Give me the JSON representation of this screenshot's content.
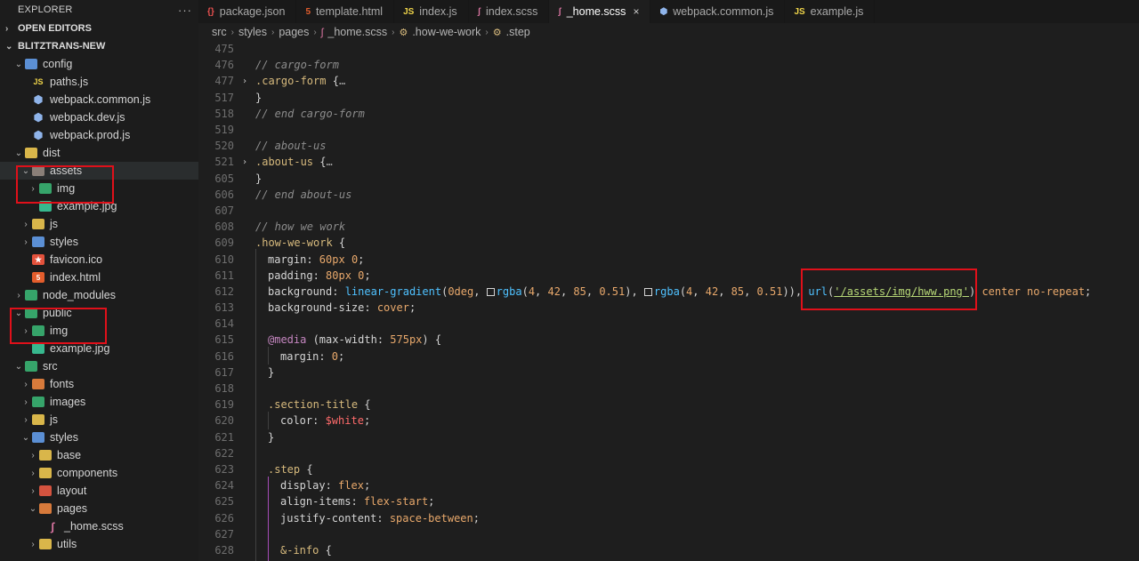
{
  "explorer": {
    "title": "EXPLORER",
    "more": "···",
    "open_editors": "OPEN EDITORS",
    "project": "BLITZTRANS-NEW"
  },
  "tree": [
    {
      "label": "config",
      "depth": 1,
      "type": "folder",
      "color": "#5b8fd4",
      "chev": "⌄"
    },
    {
      "label": "paths.js",
      "depth": 2,
      "type": "js"
    },
    {
      "label": "webpack.common.js",
      "depth": 2,
      "type": "webpack"
    },
    {
      "label": "webpack.dev.js",
      "depth": 2,
      "type": "webpack"
    },
    {
      "label": "webpack.prod.js",
      "depth": 2,
      "type": "webpack"
    },
    {
      "label": "dist",
      "depth": 1,
      "type": "folder",
      "color": "#d9b64a",
      "chev": "⌄"
    },
    {
      "label": "assets",
      "depth": 2,
      "type": "folder",
      "color": "#8a7f78",
      "chev": "⌄",
      "selected": true
    },
    {
      "label": "img",
      "depth": 3,
      "type": "folder",
      "color": "#36a46a",
      "chev": "›"
    },
    {
      "label": "example.jpg",
      "depth": 3,
      "type": "image"
    },
    {
      "label": "js",
      "depth": 2,
      "type": "folder",
      "color": "#d9b64a",
      "chev": "›"
    },
    {
      "label": "styles",
      "depth": 2,
      "type": "folder",
      "color": "#5b8fd4",
      "chev": "›"
    },
    {
      "label": "favicon.ico",
      "depth": 2,
      "type": "favicon"
    },
    {
      "label": "index.html",
      "depth": 2,
      "type": "html"
    },
    {
      "label": "node_modules",
      "depth": 1,
      "type": "folder",
      "color": "#36a46a",
      "chev": "›"
    },
    {
      "label": "public",
      "depth": 1,
      "type": "folder",
      "color": "#36a46a",
      "chev": "⌄"
    },
    {
      "label": "img",
      "depth": 2,
      "type": "folder",
      "color": "#36a46a",
      "chev": "›"
    },
    {
      "label": "example.jpg",
      "depth": 2,
      "type": "image"
    },
    {
      "label": "src",
      "depth": 1,
      "type": "folder",
      "color": "#36a46a",
      "chev": "⌄"
    },
    {
      "label": "fonts",
      "depth": 2,
      "type": "folder",
      "color": "#d77a3b",
      "chev": "›"
    },
    {
      "label": "images",
      "depth": 2,
      "type": "folder",
      "color": "#36a46a",
      "chev": "›"
    },
    {
      "label": "js",
      "depth": 2,
      "type": "folder",
      "color": "#d9b64a",
      "chev": "›"
    },
    {
      "label": "styles",
      "depth": 2,
      "type": "folder",
      "color": "#5b8fd4",
      "chev": "⌄"
    },
    {
      "label": "base",
      "depth": 3,
      "type": "folder",
      "color": "#d9b64a",
      "chev": "›"
    },
    {
      "label": "components",
      "depth": 3,
      "type": "folder",
      "color": "#d9b64a",
      "chev": "›"
    },
    {
      "label": "layout",
      "depth": 3,
      "type": "folder",
      "color": "#d4533f",
      "chev": "›"
    },
    {
      "label": "pages",
      "depth": 3,
      "type": "folder",
      "color": "#d77a3b",
      "chev": "⌄"
    },
    {
      "label": "_home.scss",
      "depth": 4,
      "type": "sass"
    },
    {
      "label": "utils",
      "depth": 3,
      "type": "folder",
      "color": "#d9b64a",
      "chev": "›"
    }
  ],
  "tabs": [
    {
      "label": "package.json",
      "icon": "{}",
      "icon_color": "#e8504f",
      "active": false
    },
    {
      "label": "template.html",
      "icon": "5",
      "icon_color": "#e35d2c",
      "active": false
    },
    {
      "label": "index.js",
      "icon": "JS",
      "icon_color": "#f0d54a",
      "active": false
    },
    {
      "label": "index.scss",
      "icon": "ʃ",
      "icon_color": "#d7739f",
      "active": false
    },
    {
      "label": "_home.scss",
      "icon": "ʃ",
      "icon_color": "#d7739f",
      "active": true
    },
    {
      "label": "webpack.common.js",
      "icon": "⬢",
      "icon_color": "#8fb4ea",
      "active": false
    },
    {
      "label": "example.js",
      "icon": "JS",
      "icon_color": "#f0d54a",
      "active": false
    }
  ],
  "close_glyph": "×",
  "breadcrumb": {
    "src": "src",
    "styles": "styles",
    "pages": "pages",
    "file": "_home.scss",
    "sym1": ".how-we-work",
    "sym2": ".step"
  },
  "code_lines": [
    {
      "n": "475",
      "indent": 0,
      "tokens": []
    },
    {
      "n": "476",
      "indent": 0,
      "tokens": [
        [
          "c",
          "// cargo-form"
        ]
      ]
    },
    {
      "n": "477",
      "indent": 0,
      "fold": "›",
      "tokens": [
        [
          "s",
          ".cargo-form"
        ],
        [
          "p",
          " {"
        ],
        [
          "e",
          "…"
        ]
      ]
    },
    {
      "n": "517",
      "indent": 0,
      "tokens": [
        [
          "p",
          "}"
        ]
      ]
    },
    {
      "n": "518",
      "indent": 0,
      "tokens": [
        [
          "c",
          "// end cargo-form"
        ]
      ]
    },
    {
      "n": "519",
      "indent": 0,
      "tokens": []
    },
    {
      "n": "520",
      "indent": 0,
      "tokens": [
        [
          "c",
          "// about-us"
        ]
      ]
    },
    {
      "n": "521",
      "indent": 0,
      "fold": "›",
      "tokens": [
        [
          "s",
          ".about-us"
        ],
        [
          "p",
          " {"
        ],
        [
          "e",
          "…"
        ]
      ]
    },
    {
      "n": "605",
      "indent": 0,
      "tokens": [
        [
          "p",
          "}"
        ]
      ]
    },
    {
      "n": "606",
      "indent": 0,
      "tokens": [
        [
          "c",
          "// end about-us"
        ]
      ]
    },
    {
      "n": "607",
      "indent": 0,
      "tokens": []
    },
    {
      "n": "608",
      "indent": 0,
      "tokens": [
        [
          "c",
          "// how we work"
        ]
      ]
    },
    {
      "n": "609",
      "indent": 0,
      "tokens": [
        [
          "s",
          ".how-we-work"
        ],
        [
          "p",
          " {"
        ]
      ]
    },
    {
      "n": "610",
      "indent": 1,
      "tokens": [
        [
          "p",
          "margin: "
        ],
        [
          "n",
          "60px"
        ],
        [
          "p",
          " "
        ],
        [
          "n",
          "0"
        ],
        [
          "p",
          ";"
        ]
      ]
    },
    {
      "n": "611",
      "indent": 1,
      "tokens": [
        [
          "p",
          "padding: "
        ],
        [
          "n",
          "80px"
        ],
        [
          "p",
          " "
        ],
        [
          "n",
          "0"
        ],
        [
          "p",
          ";"
        ]
      ]
    },
    {
      "n": "612",
      "indent": 1,
      "tokens": [
        [
          "p",
          "background: "
        ],
        [
          "f",
          "linear-gradient"
        ],
        [
          "p",
          "("
        ],
        [
          "n",
          "0deg"
        ],
        [
          "p",
          ", "
        ],
        [
          "w",
          ""
        ],
        [
          "f",
          "rgba"
        ],
        [
          "p",
          "("
        ],
        [
          "n",
          "4"
        ],
        [
          "p",
          ", "
        ],
        [
          "n",
          "42"
        ],
        [
          "p",
          ", "
        ],
        [
          "n",
          "85"
        ],
        [
          "p",
          ", "
        ],
        [
          "n",
          "0.51"
        ],
        [
          "p",
          "), "
        ],
        [
          "w",
          ""
        ],
        [
          "f",
          "rgba"
        ],
        [
          "p",
          "("
        ],
        [
          "n",
          "4"
        ],
        [
          "p",
          ", "
        ],
        [
          "n",
          "42"
        ],
        [
          "p",
          ", "
        ],
        [
          "n",
          "85"
        ],
        [
          "p",
          ", "
        ],
        [
          "n",
          "0.51"
        ],
        [
          "p",
          ")), "
        ],
        [
          "f",
          "url"
        ],
        [
          "p",
          "("
        ],
        [
          "u",
          "'/assets/img/hww.png'"
        ],
        [
          "p",
          ") "
        ],
        [
          "v",
          "center no-repeat"
        ],
        [
          "p",
          ";"
        ]
      ]
    },
    {
      "n": "613",
      "indent": 1,
      "tokens": [
        [
          "p",
          "background-size: "
        ],
        [
          "v",
          "cover"
        ],
        [
          "p",
          ";"
        ]
      ]
    },
    {
      "n": "614",
      "indent": 1,
      "tokens": []
    },
    {
      "n": "615",
      "indent": 1,
      "tokens": [
        [
          "a",
          "@media"
        ],
        [
          "p",
          " (max-width: "
        ],
        [
          "n",
          "575px"
        ],
        [
          "p",
          ") {"
        ]
      ]
    },
    {
      "n": "616",
      "indent": 2,
      "tokens": [
        [
          "p",
          "margin: "
        ],
        [
          "n",
          "0"
        ],
        [
          "p",
          ";"
        ]
      ]
    },
    {
      "n": "617",
      "indent": 1,
      "tokens": [
        [
          "p",
          "}"
        ]
      ]
    },
    {
      "n": "618",
      "indent": 1,
      "tokens": []
    },
    {
      "n": "619",
      "indent": 1,
      "tokens": [
        [
          "s",
          ".section-title"
        ],
        [
          "p",
          " {"
        ]
      ]
    },
    {
      "n": "620",
      "indent": 2,
      "tokens": [
        [
          "p",
          "color: "
        ],
        [
          "r",
          "$white"
        ],
        [
          "p",
          ";"
        ]
      ]
    },
    {
      "n": "621",
      "indent": 1,
      "tokens": [
        [
          "p",
          "}"
        ]
      ]
    },
    {
      "n": "622",
      "indent": 1,
      "tokens": []
    },
    {
      "n": "623",
      "indent": 1,
      "tokens": [
        [
          "s",
          ".step"
        ],
        [
          "p",
          " {"
        ]
      ]
    },
    {
      "n": "624",
      "indent": 2,
      "tokens": [
        [
          "p",
          "display: "
        ],
        [
          "v",
          "flex"
        ],
        [
          "p",
          ";"
        ]
      ]
    },
    {
      "n": "625",
      "indent": 2,
      "tokens": [
        [
          "p",
          "align-items: "
        ],
        [
          "v",
          "flex-start"
        ],
        [
          "p",
          ";"
        ]
      ]
    },
    {
      "n": "626",
      "indent": 2,
      "tokens": [
        [
          "p",
          "justify-content: "
        ],
        [
          "v",
          "space-between"
        ],
        [
          "p",
          ";"
        ]
      ]
    },
    {
      "n": "627",
      "indent": 2,
      "tokens": []
    },
    {
      "n": "628",
      "indent": 2,
      "tokens": [
        [
          "s",
          "&-info"
        ],
        [
          "p",
          " {"
        ]
      ]
    }
  ]
}
